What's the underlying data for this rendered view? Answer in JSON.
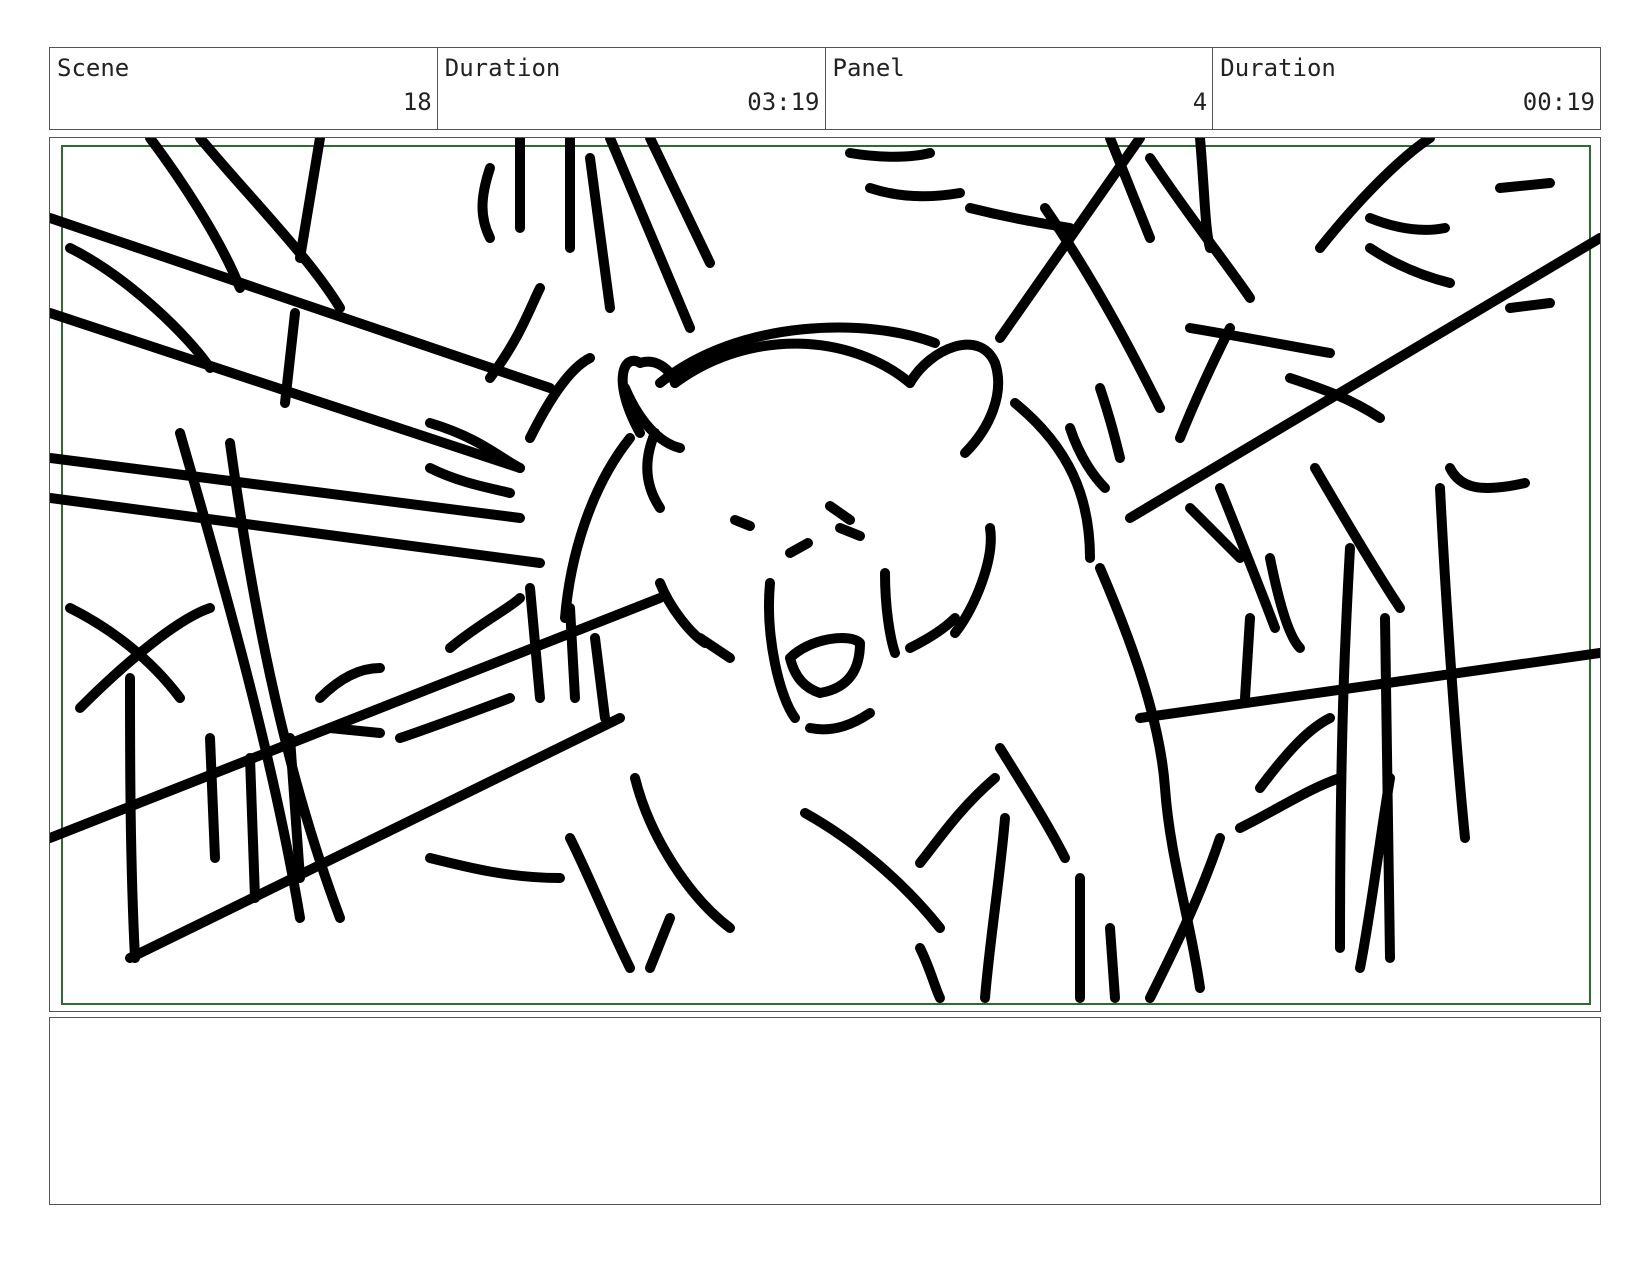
{
  "header": {
    "scene_label": "Scene",
    "scene_value": "18",
    "scene_duration_label": "Duration",
    "scene_duration_value": "03:19",
    "panel_label": "Panel",
    "panel_value": "4",
    "panel_duration_label": "Duration",
    "panel_duration_value": "00:19"
  },
  "panel": {
    "drawing": "bear-sketch",
    "safe_area_color": "#2e6b2e",
    "stroke_color": "#000000"
  },
  "notes": {
    "text": ""
  }
}
